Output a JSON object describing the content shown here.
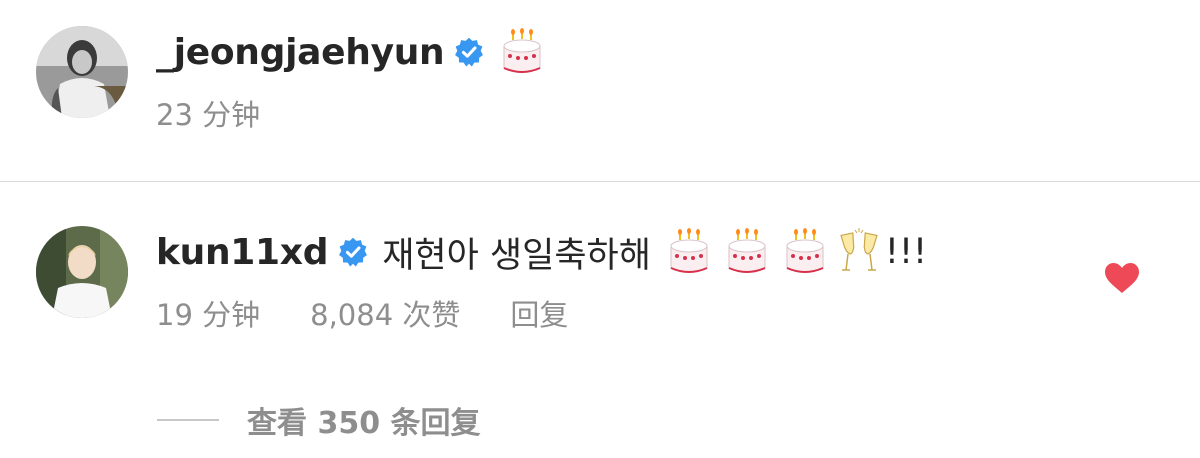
{
  "post": {
    "username": "_jeongjaehyun",
    "verified_icon": "verified-badge-icon",
    "emoji": [
      "birthday-cake-icon"
    ],
    "time": "23 分钟"
  },
  "comment": {
    "username": "kun11xd",
    "verified_icon": "verified-badge-icon",
    "text": "재현아 생일축하해",
    "emoji": [
      "birthday-cake-icon",
      "birthday-cake-icon",
      "birthday-cake-icon",
      "clinking-glasses-icon"
    ],
    "suffix": "!!!",
    "time": "19 分钟",
    "likes": "8,084 次赞",
    "reply_label": "回复",
    "liked": true,
    "like_color": "#ed4956"
  },
  "view_replies": {
    "label": "查看 350 条回复"
  },
  "colors": {
    "text_primary": "#262626",
    "text_secondary": "#8e8e8e",
    "verified_blue": "#3897f0",
    "divider": "#dbdbdb"
  }
}
